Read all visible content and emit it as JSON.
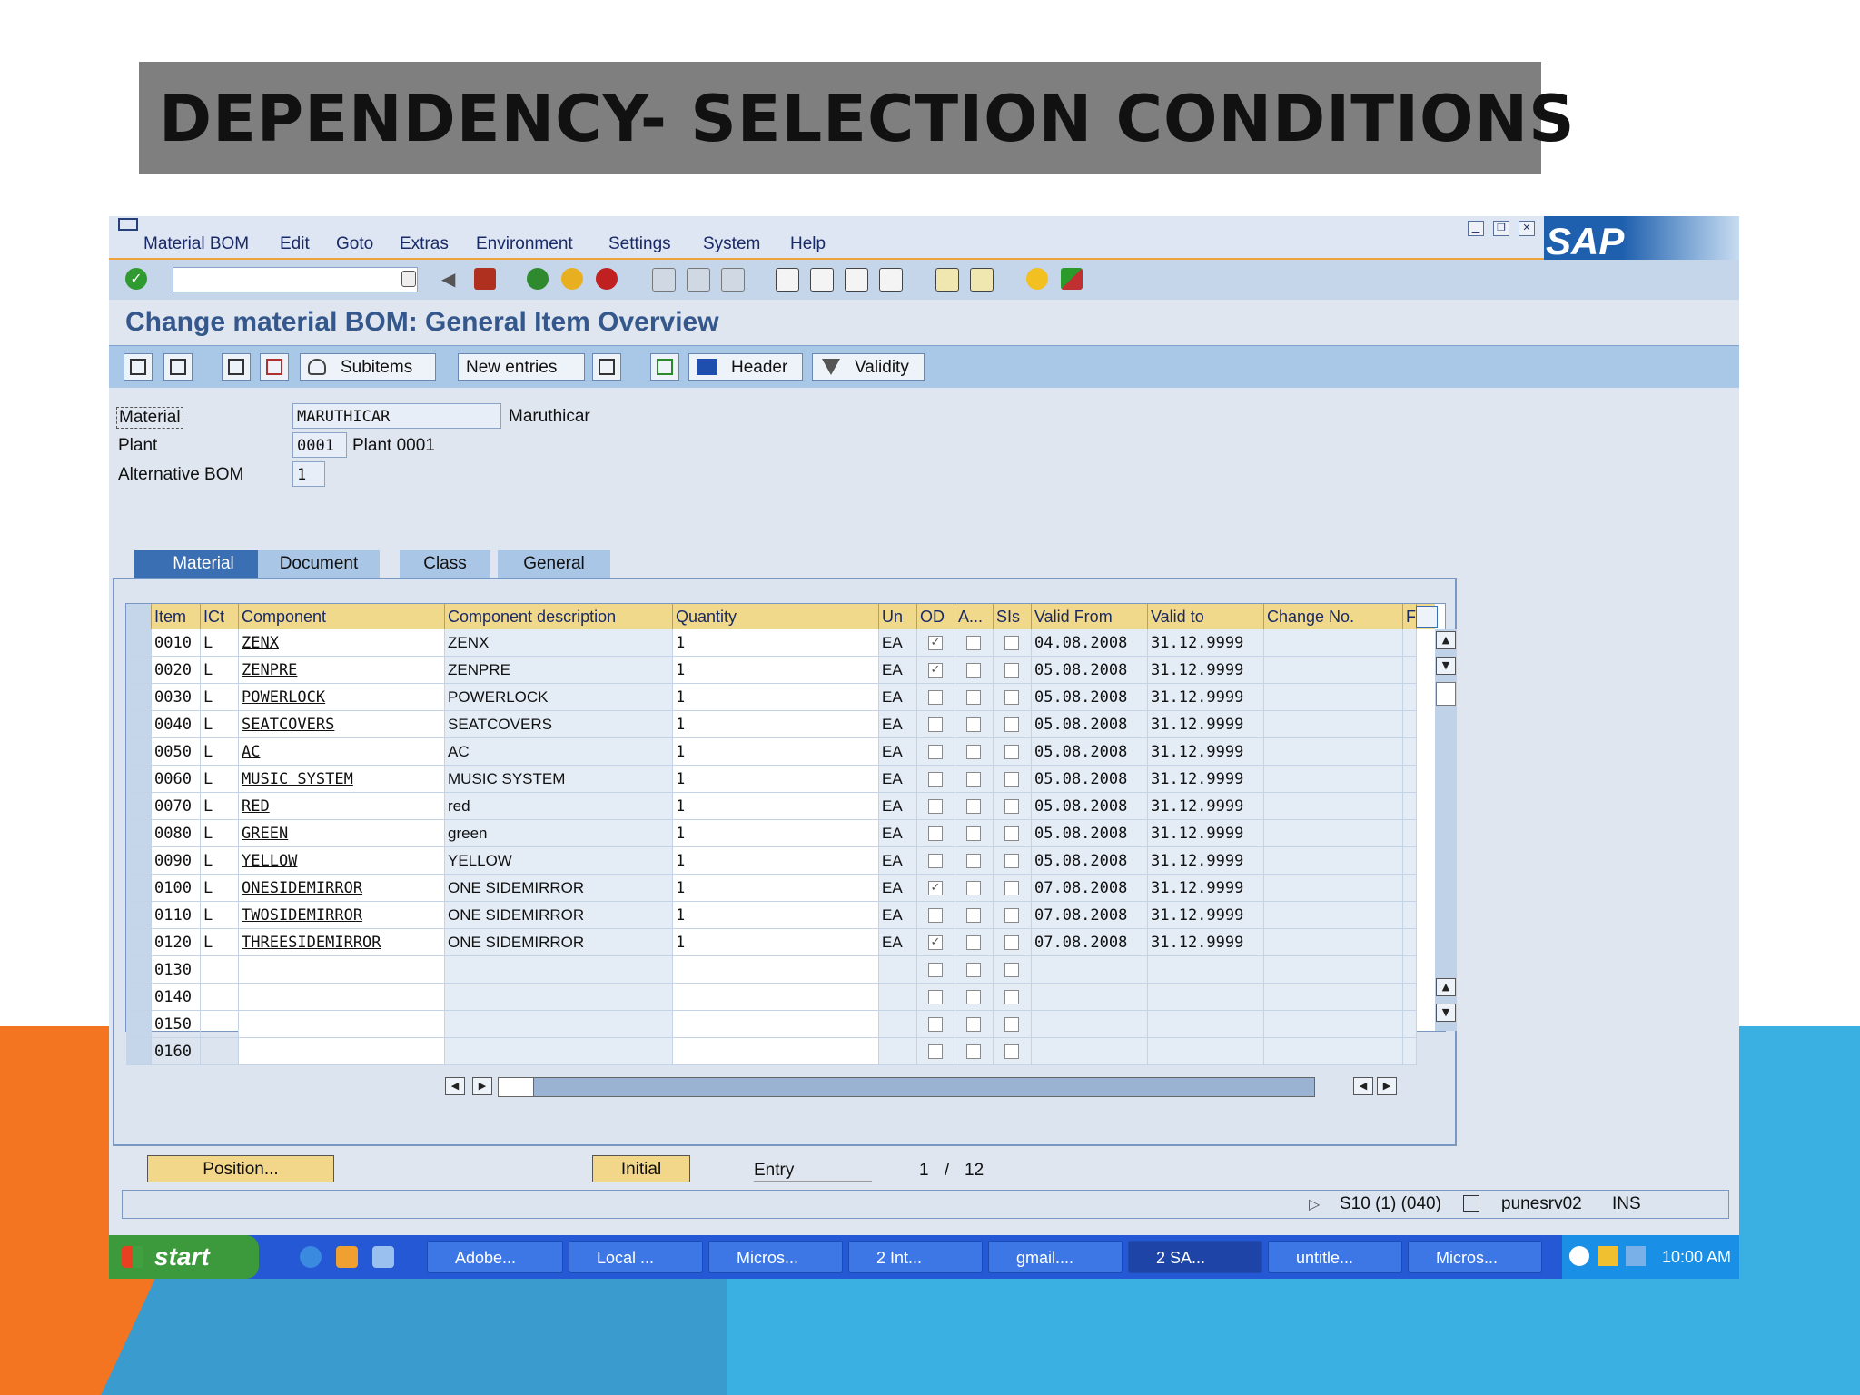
{
  "slide": {
    "title": "DEPENDENCY- SELECTION CONDITIONS"
  },
  "menu": {
    "items": [
      "Material BOM",
      "Edit",
      "Goto",
      "Extras",
      "Environment",
      "Settings",
      "System",
      "Help"
    ]
  },
  "brand": {
    "logo_text": "SAP"
  },
  "screen": {
    "title": "Change material BOM: General Item Overview"
  },
  "app_toolbar": {
    "subitems": "Subitems",
    "new_entries": "New entries",
    "header": "Header",
    "validity": "Validity"
  },
  "header_fields": {
    "material_label": "Material",
    "material_value": "MARUTHICAR",
    "material_desc": "Maruthicar",
    "plant_label": "Plant",
    "plant_value": "0001",
    "plant_desc": "Plant 0001",
    "altbom_label": "Alternative BOM",
    "altbom_value": "1"
  },
  "tabs": [
    "Material",
    "Document",
    "Class",
    "General"
  ],
  "table": {
    "columns": [
      "Item",
      "ICt",
      "Component",
      "Component description",
      "Quantity",
      "Un",
      "OD",
      "A...",
      "SIs",
      "Valid From",
      "Valid to",
      "Change No.",
      "F"
    ],
    "rows": [
      {
        "item": "0010",
        "ict": "L",
        "comp": "ZENX",
        "desc": "ZENX",
        "qty": "1",
        "un": "EA",
        "od": true,
        "from": "04.08.2008",
        "to": "31.12.9999"
      },
      {
        "item": "0020",
        "ict": "L",
        "comp": "ZENPRE",
        "desc": "ZENPRE",
        "qty": "1",
        "un": "EA",
        "od": true,
        "from": "05.08.2008",
        "to": "31.12.9999"
      },
      {
        "item": "0030",
        "ict": "L",
        "comp": "POWERLOCK",
        "desc": "POWERLOCK",
        "qty": "1",
        "un": "EA",
        "od": false,
        "from": "05.08.2008",
        "to": "31.12.9999"
      },
      {
        "item": "0040",
        "ict": "L",
        "comp": "SEATCOVERS",
        "desc": "SEATCOVERS",
        "qty": "1",
        "un": "EA",
        "od": false,
        "from": "05.08.2008",
        "to": "31.12.9999"
      },
      {
        "item": "0050",
        "ict": "L",
        "comp": "AC",
        "desc": "AC",
        "qty": "1",
        "un": "EA",
        "od": false,
        "from": "05.08.2008",
        "to": "31.12.9999"
      },
      {
        "item": "0060",
        "ict": "L",
        "comp": "MUSIC SYSTEM",
        "desc": "MUSIC SYSTEM",
        "qty": "1",
        "un": "EA",
        "od": false,
        "from": "05.08.2008",
        "to": "31.12.9999"
      },
      {
        "item": "0070",
        "ict": "L",
        "comp": "RED",
        "desc": "red",
        "qty": "1",
        "un": "EA",
        "od": false,
        "from": "05.08.2008",
        "to": "31.12.9999"
      },
      {
        "item": "0080",
        "ict": "L",
        "comp": "GREEN",
        "desc": "green",
        "qty": "1",
        "un": "EA",
        "od": false,
        "from": "05.08.2008",
        "to": "31.12.9999"
      },
      {
        "item": "0090",
        "ict": "L",
        "comp": "YELLOW",
        "desc": "YELLOW",
        "qty": "1",
        "un": "EA",
        "od": false,
        "from": "05.08.2008",
        "to": "31.12.9999"
      },
      {
        "item": "0100",
        "ict": "L",
        "comp": "ONESIDEMIRROR",
        "desc": "ONE SIDEMIRROR",
        "qty": "1",
        "un": "EA",
        "od": true,
        "from": "07.08.2008",
        "to": "31.12.9999"
      },
      {
        "item": "0110",
        "ict": "L",
        "comp": "TWOSIDEMIRROR",
        "desc": "ONE SIDEMIRROR",
        "qty": "1",
        "un": "EA",
        "od": false,
        "from": "07.08.2008",
        "to": "31.12.9999"
      },
      {
        "item": "0120",
        "ict": "L",
        "comp": "THREESIDEMIRROR",
        "desc": "ONE SIDEMIRROR",
        "qty": "1",
        "un": "EA",
        "od": true,
        "from": "07.08.2008",
        "to": "31.12.9999"
      },
      {
        "item": "0130",
        "ict": "",
        "comp": "",
        "desc": "",
        "qty": "",
        "un": "",
        "od": false,
        "from": "",
        "to": ""
      },
      {
        "item": "0140",
        "ict": "",
        "comp": "",
        "desc": "",
        "qty": "",
        "un": "",
        "od": false,
        "from": "",
        "to": ""
      },
      {
        "item": "0150",
        "ict": "",
        "comp": "",
        "desc": "",
        "qty": "",
        "un": "",
        "od": false,
        "from": "",
        "to": ""
      },
      {
        "item": "0160",
        "ict": "",
        "comp": "",
        "desc": "",
        "qty": "",
        "un": "",
        "od": false,
        "from": "",
        "to": ""
      }
    ]
  },
  "footer": {
    "position_btn": "Position...",
    "initial_btn": "Initial",
    "entry_label": "Entry",
    "entry_current": "1",
    "entry_sep": "/",
    "entry_total": "12"
  },
  "statusbar": {
    "system": "S10 (1) (040)",
    "server": "punesrv02",
    "mode": "INS"
  },
  "taskbar": {
    "start": "start",
    "tasks": [
      "Adobe...",
      "Local ...",
      "Micros...",
      "2 Int...",
      "gmail....",
      "2 SA...",
      "untitle...",
      "Micros..."
    ],
    "clock": "10:00 AM"
  }
}
